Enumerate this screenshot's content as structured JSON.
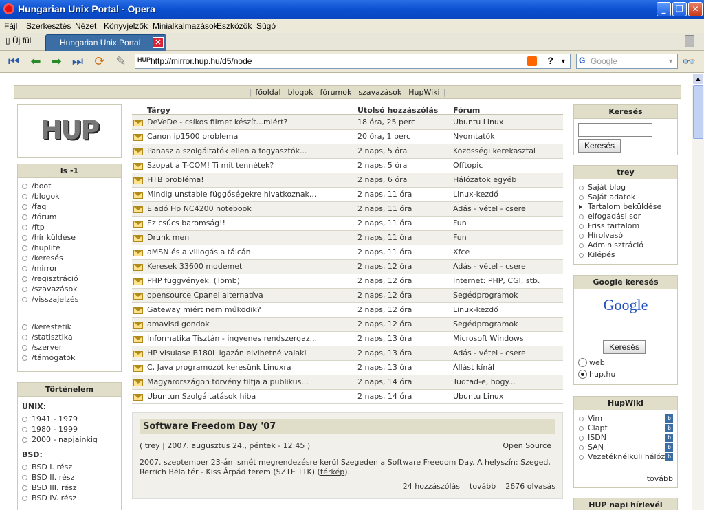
{
  "window": {
    "title": "Hungarian Unix Portal - Opera"
  },
  "menu": [
    "Fájl",
    "Szerkesztés",
    "Nézet",
    "Könyvjelzők",
    "Minialkalmazások",
    "Eszközök",
    "Súgó"
  ],
  "tabs": {
    "new_tab": "Új fül",
    "active": "Hungarian Unix Portal"
  },
  "toolbar": {
    "url": "http://mirror.hup.hu/d5/node",
    "search_placeholder": "Google",
    "search_engine": "G"
  },
  "nav": [
    "főoldal",
    "blogok",
    "fórumok",
    "szavazások",
    "HupWiki"
  ],
  "logo_text": "HUP",
  "ls": {
    "title": "ls -1",
    "items": [
      "/boot",
      "/blogok",
      "/faq",
      "/fórum",
      "/ftp",
      "/hír küldése",
      "/huplite",
      "/keresés",
      "/mirror",
      "/regisztráció",
      "/szavazások",
      "/visszajelzés"
    ],
    "items2": [
      "/kerestetik",
      "/statisztika",
      "/szerver",
      "/támogatók"
    ]
  },
  "history": {
    "title": "Történelem",
    "unix_label": "UNIX:",
    "unix": [
      "1941 - 1979",
      "1980 - 1999",
      "2000 - napjainkig"
    ],
    "bsd_label": "BSD:",
    "bsd": [
      "BSD I. rész",
      "BSD II. rész",
      "BSD III. rész",
      "BSD IV. rész"
    ]
  },
  "table": {
    "headers": [
      "Tárgy",
      "Utolsó hozzászólás",
      "Fórum"
    ],
    "rows": [
      [
        "DeVeDe - csíkos filmet készít...miért?",
        "18 óra, 25 perc",
        "Ubuntu Linux"
      ],
      [
        "Canon ip1500 problema",
        "20 óra, 1 perc",
        "Nyomtatók"
      ],
      [
        "Panasz a szolgáltatók ellen a fogyasztók...",
        "2 naps, 5 óra",
        "Közösségi kerekasztal"
      ],
      [
        "Szopat a T-COM! Ti mit tennétek?",
        "2 naps, 5 óra",
        "Offtopic"
      ],
      [
        "HTB probléma!",
        "2 naps, 6 óra",
        "Hálózatok egyéb"
      ],
      [
        "Mindig unstable függőségekre hivatkoznak...",
        "2 naps, 11 óra",
        "Linux-kezdő"
      ],
      [
        "Eladó Hp NC4200 notebook",
        "2 naps, 11 óra",
        "Adás - vétel - csere"
      ],
      [
        "Ez csúcs baromság!!",
        "2 naps, 11 óra",
        "Fun"
      ],
      [
        "Drunk men",
        "2 naps, 11 óra",
        "Fun"
      ],
      [
        "aMSN és a villogás a tálcán",
        "2 naps, 11 óra",
        "Xfce"
      ],
      [
        "Keresek 33600 modemet",
        "2 naps, 12 óra",
        "Adás - vétel - csere"
      ],
      [
        "PHP függvények. (Tömb)",
        "2 naps, 12 óra",
        "Internet: PHP, CGI, stb."
      ],
      [
        "opensource Cpanel alternatíva",
        "2 naps, 12 óra",
        "Segédprogramok"
      ],
      [
        "Gateway miért nem működik?",
        "2 naps, 12 óra",
        "Linux-kezdő"
      ],
      [
        "amavisd gondok",
        "2 naps, 12 óra",
        "Segédprogramok"
      ],
      [
        "Informatika Tisztán - ingyenes rendszergaz...",
        "2 naps, 13 óra",
        "Microsoft Windows"
      ],
      [
        "HP visulase B180L igazán elvihetné valaki",
        "2 naps, 13 óra",
        "Adás - vétel - csere"
      ],
      [
        "C, Java programozót keresünk Linuxra",
        "2 naps, 13 óra",
        "Állást kínál"
      ],
      [
        "Magyarországon törvény tiltja a publikus...",
        "2 naps, 14 óra",
        "Tudtad-e, hogy..."
      ],
      [
        "Ubuntun Szolgáltatások hiba",
        "2 naps, 14 óra",
        "Ubuntu Linux"
      ]
    ]
  },
  "article": {
    "title": "Software Freedom Day '07",
    "meta": "( trey | 2007. augusztus 24., péntek - 12:45 )",
    "category": "Open Source",
    "body_pre": "2007. szeptember 23-án ismét megrendezésre kerül Szegeden a Software Freedom Day. A helyszín: Szeged, Rerrich Béla tér - Kiss Árpád terem (SZTE TTK) (",
    "body_link": "térkép",
    "body_post": ").",
    "comments": "24 hozzászólás",
    "more": "tovább",
    "reads": "2676 olvasás"
  },
  "search": {
    "title": "Keresés",
    "button": "Keresés"
  },
  "user": {
    "title": "trey",
    "items": [
      "Saját blog",
      "Saját adatok",
      "Tartalom beküldése",
      "elfogadási sor",
      "Friss tartalom",
      "Hírolvasó",
      "Adminisztráció",
      "Kilépés"
    ]
  },
  "google": {
    "title": "Google keresés",
    "logo": "Google",
    "button": "Keresés",
    "opt1": "web",
    "opt2": "hup.hu"
  },
  "hupwiki": {
    "title": "HupWiki",
    "items": [
      "Vim",
      "Clapf",
      "ISDN",
      "SAN",
      "Vezetéknélküli hálózat"
    ],
    "more": "tovább",
    "icon": "b"
  },
  "news": {
    "title": "HUP napi hírlevél"
  }
}
